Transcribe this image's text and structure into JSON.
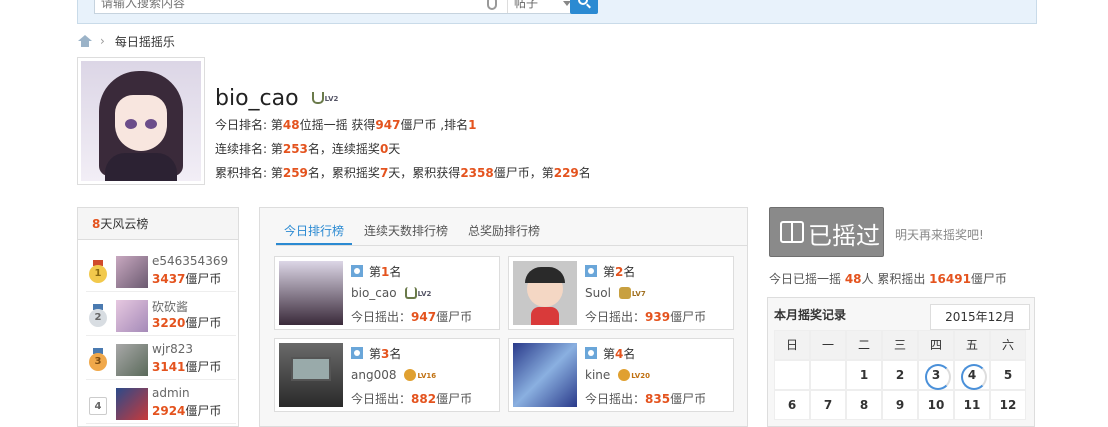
{
  "header": {
    "search_placeholder": "请输入搜索内容",
    "search_type": "帖子"
  },
  "breadcrumb": {
    "current": "每日摇摇乐",
    "separator": "›"
  },
  "profile": {
    "username": "bio_cao",
    "level": "LV2",
    "today": {
      "prefix": "今日排名: 第",
      "rank": "48",
      "mid": "位摇一摇 获得",
      "coins": "947",
      "unit": "僵尸币 ,排名",
      "pos": "1"
    },
    "streak": {
      "prefix": "连续排名: 第",
      "rank": "253",
      "mid": "名，连续摇奖",
      "days": "0",
      "unit": "天"
    },
    "total": {
      "prefix": "累积排名: 第",
      "rank": "259",
      "m1": "名，累积摇奖",
      "days": "7",
      "m2": "天，累积获得",
      "coins": "2358",
      "m3": "僵尸币，第",
      "pos": "229",
      "m4": "名"
    }
  },
  "left_board": {
    "title_num": "8",
    "title_text": "天风云榜",
    "items": [
      {
        "rank": "1",
        "name": "e546354369",
        "value": "3437",
        "unit": "僵尸币"
      },
      {
        "rank": "2",
        "name": "砍砍酱",
        "value": "3220",
        "unit": "僵尸币"
      },
      {
        "rank": "3",
        "name": "wjr823",
        "value": "3141",
        "unit": "僵尸币"
      },
      {
        "rank": "4",
        "name": "admin",
        "value": "2924",
        "unit": "僵尸币"
      }
    ]
  },
  "tabs": [
    "今日排行榜",
    "连续天数排行榜",
    "总奖励排行榜"
  ],
  "cards": [
    {
      "rank_prefix": "第",
      "rank": "1",
      "rank_suffix": "名",
      "name": "bio_cao",
      "level": "LV2",
      "level_color": "#6a7a4a",
      "label": "今日摇出：",
      "value": "947",
      "unit": "僵尸币"
    },
    {
      "rank_prefix": "第",
      "rank": "2",
      "rank_suffix": "名",
      "name": "Suol",
      "level": "LV7",
      "level_color": "#c8a040",
      "label": "今日摇出：",
      "value": "939",
      "unit": "僵尸币"
    },
    {
      "rank_prefix": "第",
      "rank": "3",
      "rank_suffix": "名",
      "name": "ang008",
      "level": "LV16",
      "level_color": "#e0a030",
      "label": "今日摇出：",
      "value": "882",
      "unit": "僵尸币"
    },
    {
      "rank_prefix": "第",
      "rank": "4",
      "rank_suffix": "名",
      "name": "kine",
      "level": "LV20",
      "level_color": "#e0a030",
      "label": "今日摇出：",
      "value": "835",
      "unit": "僵尸币"
    }
  ],
  "shake": {
    "button_label": "已摇过",
    "tomorrow": "明天再来摇奖吧!",
    "summary_a": "今日已摇一摇 ",
    "summary_people": "48",
    "summary_b": "人 累积摇出 ",
    "summary_coins": "16491",
    "summary_c": "僵尸币"
  },
  "calendar": {
    "title": "本月摇奖记录",
    "month": "2015年12月",
    "weekdays": [
      "日",
      "一",
      "二",
      "三",
      "四",
      "五",
      "六"
    ],
    "week1": [
      "",
      "",
      "1",
      "2",
      "3",
      "4",
      "5"
    ],
    "week2": [
      "6",
      "7",
      "8",
      "9",
      "10",
      "11",
      "12"
    ],
    "marked": [
      "3",
      "4"
    ]
  },
  "colors": {
    "accent": "#2b8ad2",
    "highlight": "#e4531e"
  }
}
